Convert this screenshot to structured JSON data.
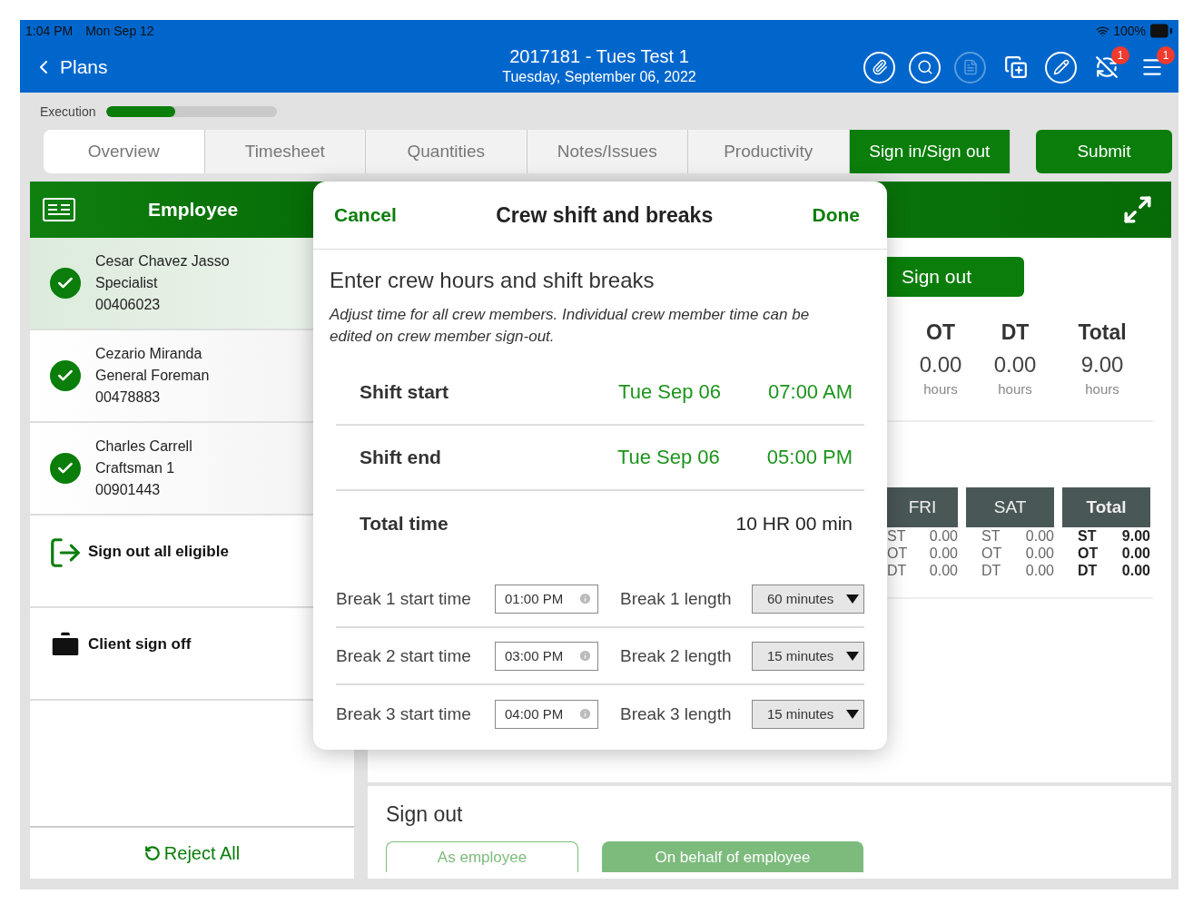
{
  "status_bar": {
    "time": "1:04 PM",
    "date": "Mon Sep 12",
    "battery": "100%"
  },
  "nav": {
    "back": "Plans",
    "title": "2017181 - Tues Test 1",
    "subtitle": "Tuesday, September 06, 2022",
    "tools": [
      {
        "kind": "paperclip",
        "disabled": false
      },
      {
        "kind": "inspect",
        "disabled": false
      },
      {
        "kind": "document",
        "disabled": true
      },
      {
        "kind": "copy",
        "disabled": false
      },
      {
        "kind": "pencil",
        "disabled": false
      },
      {
        "kind": "sync",
        "disabled": false,
        "badge": "1"
      },
      {
        "kind": "menu",
        "disabled": false,
        "badge": "1"
      }
    ]
  },
  "execution": {
    "label": "Execution",
    "level": 0.4
  },
  "tabs": [
    {
      "label": "Overview",
      "selected": false
    },
    {
      "label": "Timesheet",
      "selected": false
    },
    {
      "label": "Quantities",
      "selected": false
    },
    {
      "label": "Notes/Issues",
      "selected": false
    },
    {
      "label": "Productivity",
      "selected": false
    },
    {
      "label": "Sign in/Sign out",
      "selected": true
    }
  ],
  "submit": "Submit",
  "employee_panel": {
    "title": "Employee",
    "employees": [
      {
        "name": "Cesar Chavez Jasso",
        "role": "Specialist",
        "number": "00406023",
        "selected": true,
        "checked": true
      },
      {
        "name": "Cezario Miranda",
        "role": "General Foreman",
        "number": "00478883",
        "selected": false,
        "checked": true
      },
      {
        "name": "Charles Carrell",
        "role": "Craftsman 1",
        "number": "00901443",
        "selected": false,
        "checked": true
      }
    ],
    "actions": [
      {
        "kind": "sign-out",
        "label": "Sign out all eligible"
      },
      {
        "kind": "client",
        "label": "Client sign off"
      }
    ],
    "reject": "Reject All"
  },
  "summary": {
    "sign_out": "Sign out",
    "stats": [
      {
        "label": "OT",
        "value": "0.00",
        "unit": "hours"
      },
      {
        "label": "DT",
        "value": "0.00",
        "unit": "hours"
      },
      {
        "label": "Total",
        "value": "9.00",
        "unit": "hours"
      }
    ],
    "week": [
      {
        "day": "FRI",
        "kind": "day",
        "rows": [
          {
            "code": "ST",
            "value": "0.00"
          },
          {
            "code": "OT",
            "value": "0.00"
          },
          {
            "code": "DT",
            "value": "0.00"
          }
        ]
      },
      {
        "day": "SAT",
        "kind": "day",
        "rows": [
          {
            "code": "ST",
            "value": "0.00"
          },
          {
            "code": "OT",
            "value": "0.00"
          },
          {
            "code": "DT",
            "value": "0.00"
          }
        ]
      },
      {
        "day": "Total",
        "kind": "total",
        "rows": [
          {
            "code": "ST",
            "value": "9.00"
          },
          {
            "code": "OT",
            "value": "0.00"
          },
          {
            "code": "DT",
            "value": "0.00"
          }
        ]
      }
    ]
  },
  "sign_out_section": {
    "title": "Sign out",
    "buttons": [
      {
        "label": "As employee",
        "kind": "outline"
      },
      {
        "label": "On behalf of employee",
        "kind": "filled"
      }
    ]
  },
  "dialog": {
    "cancel": "Cancel",
    "title": "Crew shift and breaks",
    "done": "Done",
    "heading": "Enter crew hours and shift breaks",
    "description": "Adjust time for all crew members. Individual crew member time can be edited on crew member sign-out.",
    "shifts": [
      {
        "label": "Shift start",
        "date": "Tue Sep 06",
        "time": "07:00 AM"
      },
      {
        "label": "Shift end",
        "date": "Tue Sep 06",
        "time": "05:00 PM"
      }
    ],
    "total": {
      "label": "Total time",
      "value": "10 HR 00 min"
    },
    "breaks": [
      {
        "start_label": "Break 1 start time",
        "start": "01:00 PM",
        "length_label": "Break 1 length",
        "length": "60 minutes"
      },
      {
        "start_label": "Break 2 start time",
        "start": "03:00 PM",
        "length_label": "Break 2 length",
        "length": "15 minutes"
      },
      {
        "start_label": "Break 3 start time",
        "start": "04:00 PM",
        "length_label": "Break 3 length",
        "length": "15 minutes"
      }
    ]
  }
}
